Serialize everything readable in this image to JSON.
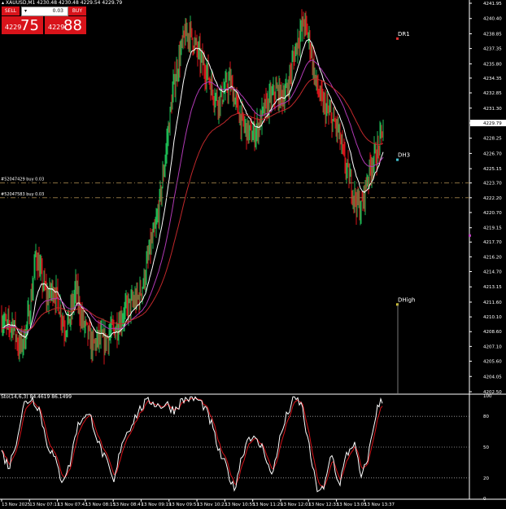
{
  "header": {
    "symbol_line": "XAUUSD,M1  4230.48 4230.48 4229.54 4229.79"
  },
  "trade_panel": {
    "sell_label": "SELL",
    "buy_label": "BUY",
    "volume": "0.03",
    "sell_price_small": "4229",
    "sell_price_big": "75",
    "buy_price_small": "4229",
    "buy_price_big": "88"
  },
  "price_axis": {
    "ticks": [
      "4241.95",
      "4240.40",
      "4238.85",
      "4237.35",
      "4235.80",
      "4234.35",
      "4232.85",
      "4231.30",
      "4229.79",
      "4228.25",
      "4226.70",
      "4225.15",
      "4223.70",
      "4222.20",
      "4220.70",
      "4219.15",
      "4217.70",
      "4216.20",
      "4214.70",
      "4213.15",
      "4211.60",
      "4210.10",
      "4208.60",
      "4207.10",
      "4205.60",
      "4204.05",
      "4202.50"
    ],
    "current_price": "4229.79"
  },
  "order_labels": [
    {
      "text": "#52047429 buy 0.03",
      "price": 4223.7
    },
    {
      "text": "#52047583 buy 0.03",
      "price": 4222.2
    }
  ],
  "level_labels": [
    {
      "text": "DR1",
      "price": 4238.4
    },
    {
      "text": "DH3",
      "price": 4226.1
    },
    {
      "text": "DHigh",
      "price": 4211.4
    }
  ],
  "time_axis": [
    "13 Nov 2025",
    "13 Nov 07:11",
    "13 Nov 07:43",
    "13 Nov 08:15",
    "13 Nov 08:47",
    "13 Nov 09:19",
    "13 Nov 09:51",
    "13 Nov 10:23",
    "13 Nov 10:55",
    "13 Nov 11:29",
    "13 Nov 12:01",
    "13 Nov 12:33",
    "13 Nov 13:05",
    "13 Nov 13:37"
  ],
  "indicator": {
    "label": "Sto(14,6,3) 84.4619 86.1499",
    "levels": [
      "100",
      "80",
      "50",
      "20",
      "0"
    ]
  },
  "colors": {
    "bull": "#1db954",
    "bear": "#d8131a",
    "ma_fast": "#ffffff",
    "ma_mid": "#b03ab5",
    "ma_slow": "#c0282b",
    "order_line": "#8a7040",
    "stoch_main": "#ffffff",
    "stoch_signal": "#d8131a",
    "level_marker_red": "#e03030",
    "level_marker_teal": "#3fc0d0",
    "level_marker_yellow": "#e0d030",
    "purple_dot": "#c040c0",
    "trade_red": "#d8131a"
  },
  "chart_data": {
    "type": "candlestick",
    "price_range": [
      4202.5,
      4241.95
    ],
    "close_path": [
      4210,
      4209,
      4209.5,
      4207,
      4208,
      4211,
      4216.5,
      4214,
      4212,
      4213,
      4211.5,
      4209,
      4210,
      4213,
      4210,
      4208.5,
      4207,
      4208,
      4207.5,
      4208.5,
      4209,
      4210,
      4211,
      4211.5,
      4212,
      4214,
      4217,
      4219,
      4223,
      4228,
      4233,
      4236,
      4238.5,
      4239,
      4237.5,
      4236,
      4235,
      4233,
      4232,
      4233,
      4234,
      4232,
      4230,
      4229,
      4228.5,
      4229.5,
      4231,
      4232,
      4233,
      4232.5,
      4233,
      4236,
      4238.5,
      4240,
      4238,
      4234,
      4232,
      4231,
      4230,
      4229,
      4226,
      4224,
      4222,
      4221,
      4224,
      4226,
      4227,
      4229.8
    ],
    "stochastic": [
      45,
      30,
      58,
      92,
      98,
      88,
      55,
      40,
      18,
      30,
      68,
      82,
      78,
      52,
      35,
      14,
      55,
      68,
      82,
      92,
      95,
      90,
      92,
      86,
      95,
      98,
      97,
      90,
      72,
      45,
      30,
      8,
      40,
      62,
      55,
      48,
      20,
      55,
      80,
      98,
      92,
      50,
      10,
      8,
      45,
      12,
      42,
      55,
      18,
      45,
      86,
      99
    ]
  }
}
